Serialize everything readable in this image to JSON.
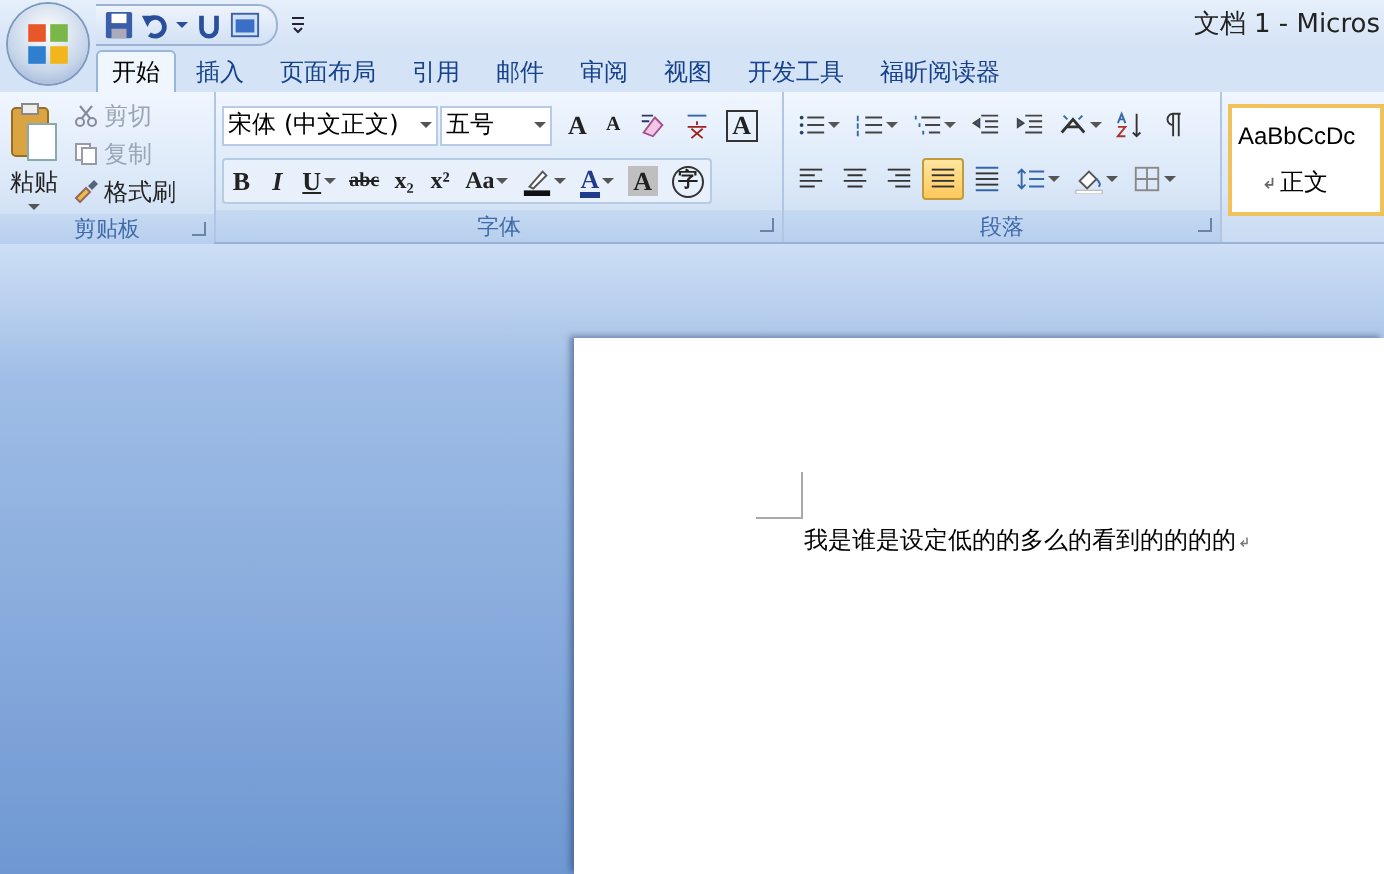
{
  "window": {
    "title": "文档 1 - Micros"
  },
  "tabs": [
    {
      "label": "开始",
      "selected": true
    },
    {
      "label": "插入",
      "selected": false
    },
    {
      "label": "页面布局",
      "selected": false
    },
    {
      "label": "引用",
      "selected": false
    },
    {
      "label": "邮件",
      "selected": false
    },
    {
      "label": "审阅",
      "selected": false
    },
    {
      "label": "视图",
      "selected": false
    },
    {
      "label": "开发工具",
      "selected": false
    },
    {
      "label": "福昕阅读器",
      "selected": false
    }
  ],
  "clipboard": {
    "paste": "粘贴",
    "label": "剪贴板",
    "items": [
      {
        "kind": "cut",
        "label": "剪切",
        "disabled": true
      },
      {
        "kind": "copy",
        "label": "复制",
        "disabled": true
      },
      {
        "kind": "painter",
        "label": "格式刷",
        "disabled": false
      }
    ]
  },
  "font": {
    "label": "字体",
    "font_name": "宋体 (中文正文)",
    "font_size": "五号",
    "row1": [
      {
        "kind": "grow",
        "label": "A",
        "dropdown": false
      },
      {
        "kind": "shrink",
        "label": "A",
        "dropdown": false
      },
      {
        "kind": "clear",
        "dropdown": false
      },
      {
        "kind": "phonetic",
        "dropdown": false
      },
      {
        "kind": "border",
        "label": "A",
        "dropdown": false
      }
    ],
    "row2": [
      {
        "kind": "bold",
        "label": "B",
        "dropdown": false
      },
      {
        "kind": "italic",
        "label": "I",
        "dropdown": false
      },
      {
        "kind": "underline",
        "label": "U",
        "dropdown": true
      },
      {
        "kind": "strike",
        "label": "abc",
        "dropdown": false
      },
      {
        "kind": "sub",
        "label": "x₂",
        "dropdown": false
      },
      {
        "kind": "sup",
        "label": "x²",
        "dropdown": false
      },
      {
        "kind": "case",
        "label": "Aa",
        "dropdown": true
      },
      {
        "kind": "highlight",
        "dropdown": true
      },
      {
        "kind": "color",
        "label": "A",
        "dropdown": true
      },
      {
        "kind": "shade",
        "label": "A",
        "dropdown": false
      },
      {
        "kind": "enclose",
        "label": "字",
        "dropdown": false
      }
    ]
  },
  "paragraph": {
    "label": "段落",
    "row1": [
      {
        "kind": "bullets",
        "dropdown": true
      },
      {
        "kind": "numbering",
        "dropdown": true
      },
      {
        "kind": "multilevel",
        "dropdown": true
      },
      {
        "kind": "outdent",
        "dropdown": false
      },
      {
        "kind": "indent",
        "dropdown": false
      },
      {
        "kind": "asian",
        "dropdown": true
      },
      {
        "kind": "sort",
        "dropdown": false
      },
      {
        "kind": "marks",
        "dropdown": false
      }
    ],
    "alignment": [
      {
        "kind": "left",
        "selected": false
      },
      {
        "kind": "center",
        "selected": false
      },
      {
        "kind": "right",
        "selected": false
      },
      {
        "kind": "justify",
        "selected": true
      },
      {
        "kind": "distributed",
        "selected": false
      }
    ],
    "row2": [
      {
        "kind": "spacing",
        "dropdown": true
      },
      {
        "kind": "fill",
        "dropdown": true
      },
      {
        "kind": "borders",
        "dropdown": true
      }
    ]
  },
  "styles": {
    "preview": "AaBbCcDc",
    "name": "正文",
    "selected": true
  },
  "document": {
    "text": "我是谁是设定低的的多么的看到的的的的"
  }
}
